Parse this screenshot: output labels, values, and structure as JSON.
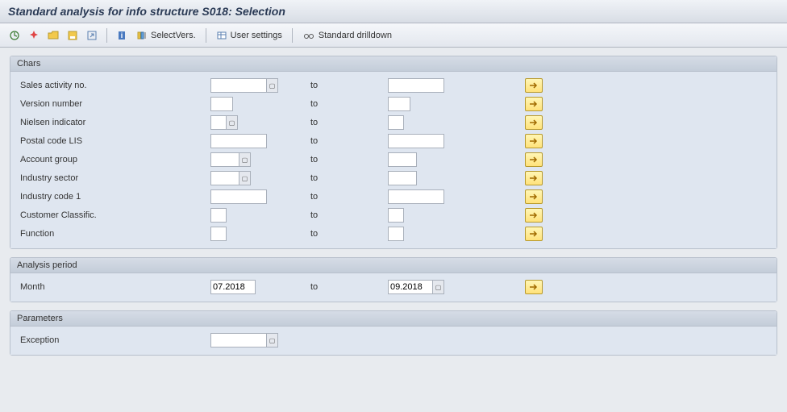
{
  "title": "Standard analysis for info structure S018: Selection",
  "toolbar": {
    "select_vers": "SelectVers.",
    "user_settings": "User settings",
    "std_drilldown": "Standard drilldown"
  },
  "groups": {
    "chars": {
      "title": "Chars",
      "to_label": "to",
      "rows": [
        {
          "label": "Sales activity no.",
          "from": "",
          "to": "",
          "from_w": 70,
          "to_w": 70,
          "help": true
        },
        {
          "label": "Version number",
          "from": "",
          "to": "",
          "from_w": 28,
          "to_w": 28,
          "help": false
        },
        {
          "label": "Nielsen indicator",
          "from": "",
          "to": "",
          "from_w": 20,
          "to_w": 20,
          "help": true
        },
        {
          "label": "Postal code LIS",
          "from": "",
          "to": "",
          "from_w": 70,
          "to_w": 70,
          "help": false
        },
        {
          "label": "Account group",
          "from": "",
          "to": "",
          "from_w": 36,
          "to_w": 36,
          "help": true
        },
        {
          "label": "Industry sector",
          "from": "",
          "to": "",
          "from_w": 36,
          "to_w": 36,
          "help": true
        },
        {
          "label": "Industry code 1",
          "from": "",
          "to": "",
          "from_w": 70,
          "to_w": 70,
          "help": false
        },
        {
          "label": "Customer Classific.",
          "from": "",
          "to": "",
          "from_w": 20,
          "to_w": 20,
          "help": false
        },
        {
          "label": "Function",
          "from": "",
          "to": "",
          "from_w": 20,
          "to_w": 20,
          "help": false
        }
      ]
    },
    "period": {
      "title": "Analysis period",
      "to_label": "to",
      "row": {
        "label": "Month",
        "from": "07.2018",
        "to": "09.2018",
        "from_w": 56,
        "to_w": 56
      }
    },
    "params": {
      "title": "Parameters",
      "row": {
        "label": "Exception",
        "value": "",
        "w": 70
      }
    }
  }
}
